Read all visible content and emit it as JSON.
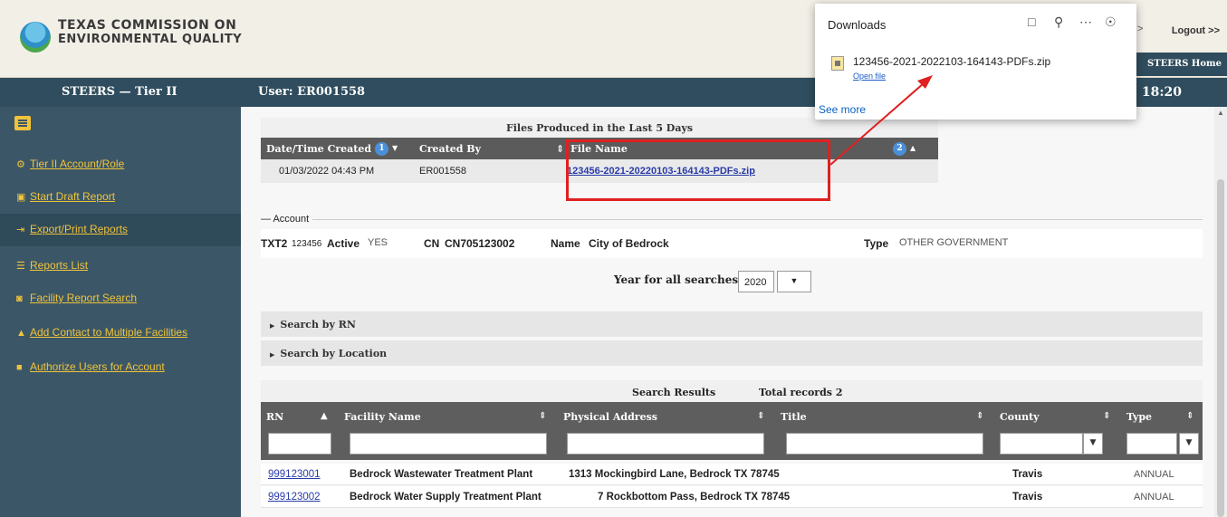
{
  "header": {
    "org_line1": "TEXAS COMMISSION ON",
    "org_line2": "ENVIRONMENTAL QUALITY",
    "logout": "Logout >>",
    "arrow": ">",
    "steers_home": "STEERS Home"
  },
  "band": {
    "tier": "STEERS — Tier II",
    "user": "User: ER001558",
    "time": "18:20"
  },
  "sidebar": {
    "items": [
      {
        "icon": "gear-icon",
        "glyph": "⚙",
        "label": "Tier II Account/Role"
      },
      {
        "icon": "card-icon",
        "glyph": "▣",
        "label": "Start Draft Report"
      },
      {
        "icon": "export-icon",
        "glyph": "⇥",
        "label": "Export/Print Reports"
      },
      {
        "icon": "list-icon",
        "glyph": "☰",
        "label": "Reports List"
      },
      {
        "icon": "binoculars-icon",
        "glyph": "◙",
        "label": "Facility Report Search"
      },
      {
        "icon": "user-icon",
        "glyph": "▲",
        "label": "Add Contact to Multiple Facilities"
      },
      {
        "icon": "lock-icon",
        "glyph": "■",
        "label": "Authorize Users for Account"
      }
    ]
  },
  "files": {
    "title": "Files Produced in the Last 5 Days",
    "col_date": "Date/Time Created",
    "col_date_badge": "1",
    "col_created": "Created By",
    "col_file": "File Name",
    "col_file_badge": "2",
    "row": {
      "date": "01/03/2022 04:43 PM",
      "created": "ER001558",
      "file": "123456-2021-20220103-164143-PDFs.zip"
    }
  },
  "account": {
    "legend": "— Account",
    "id_prefix": "TXT2",
    "id_num": "123456",
    "active_label": "Active",
    "active_val": "YES",
    "cn_label": "CN",
    "cn_val": "CN705123002",
    "name_label": "Name",
    "name_val": "City of Bedrock",
    "type_label": "Type",
    "type_val": "OTHER GOVERNMENT"
  },
  "search": {
    "year_label": "Year for all searches",
    "year_value": "2020",
    "by_rn": "Search by RN",
    "by_location": "Search by Location"
  },
  "results": {
    "title": "Search Results",
    "total": "Total records 2",
    "cols": {
      "rn": "RN",
      "facility": "Facility Name",
      "address": "Physical Address",
      "title": "Title",
      "county": "County",
      "type": "Type"
    },
    "rows": [
      {
        "rn": "999123001",
        "facility": "Bedrock Wastewater Treatment Plant",
        "address": "1313 Mockingbird Lane, Bedrock TX 78745",
        "county": "Travis",
        "type": "ANNUAL"
      },
      {
        "rn": "999123002",
        "facility": "Bedrock Water Supply Treatment Plant",
        "address": "7 Rockbottom Pass, Bedrock TX 78745",
        "county": "Travis",
        "type": "ANNUAL"
      }
    ]
  },
  "downloads": {
    "title": "Downloads",
    "file": "123456-2021-2022103-164143-PDFs.zip",
    "open": "Open file",
    "see_more": "See more"
  },
  "colors": {
    "header_bg": "#f2efe7",
    "band_bg": "#2f4d5e",
    "sidebar_bg": "#3b5767",
    "link_yellow": "#f0c33b",
    "highlight_red": "#e02020"
  }
}
